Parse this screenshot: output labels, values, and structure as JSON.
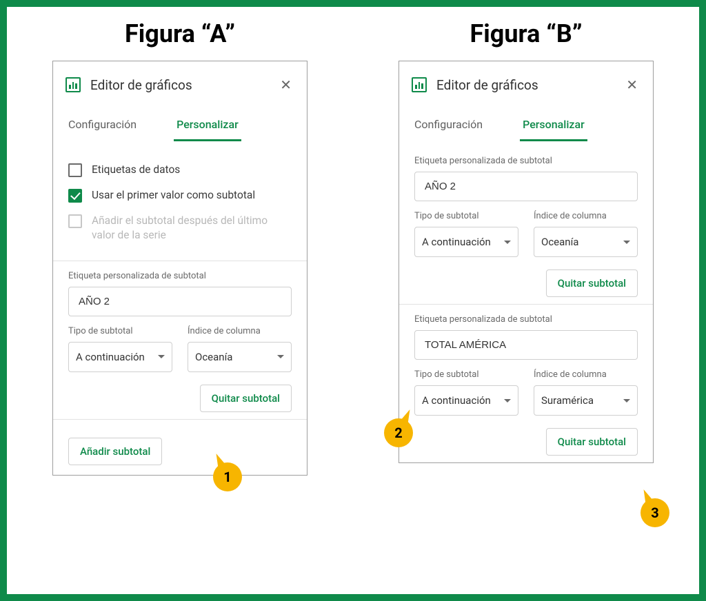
{
  "figures": {
    "a_title": "Figura “A”",
    "b_title": "Figura “B”"
  },
  "panel": {
    "title": "Editor de gráficos",
    "tabs": {
      "config": "Configuración",
      "customize": "Personalizar"
    }
  },
  "panelA": {
    "checks": {
      "data_labels": "Etiquetas de datos",
      "use_first_subtotal": "Usar el primer valor como subtotal",
      "add_subtotal_after_last": "Añadir el subtotal después del último valor de la serie"
    },
    "subtotal1": {
      "label": "Etiqueta personalizada de subtotal",
      "value": "AÑO 2",
      "type_label": "Tipo de subtotal",
      "type_value": "A continuación",
      "index_label": "Índice de columna",
      "index_value": "Oceanía"
    },
    "buttons": {
      "remove": "Quitar subtotal",
      "add": "Añadir subtotal"
    }
  },
  "panelB": {
    "subtotal1": {
      "label": "Etiqueta personalizada de subtotal",
      "value": "AÑO 2",
      "type_label": "Tipo de subtotal",
      "type_value": "A continuación",
      "index_label": "Índice de columna",
      "index_value": "Oceanía"
    },
    "subtotal2": {
      "label": "Etiqueta personalizada de subtotal",
      "value": "TOTAL AMÉRICA",
      "type_label": "Tipo de subtotal",
      "type_value": "A continuación",
      "index_label": "Índice de columna",
      "index_value": "Suramérica"
    },
    "buttons": {
      "remove": "Quitar subtotal"
    }
  },
  "callouts": {
    "one": "1",
    "two": "2",
    "three": "3"
  }
}
